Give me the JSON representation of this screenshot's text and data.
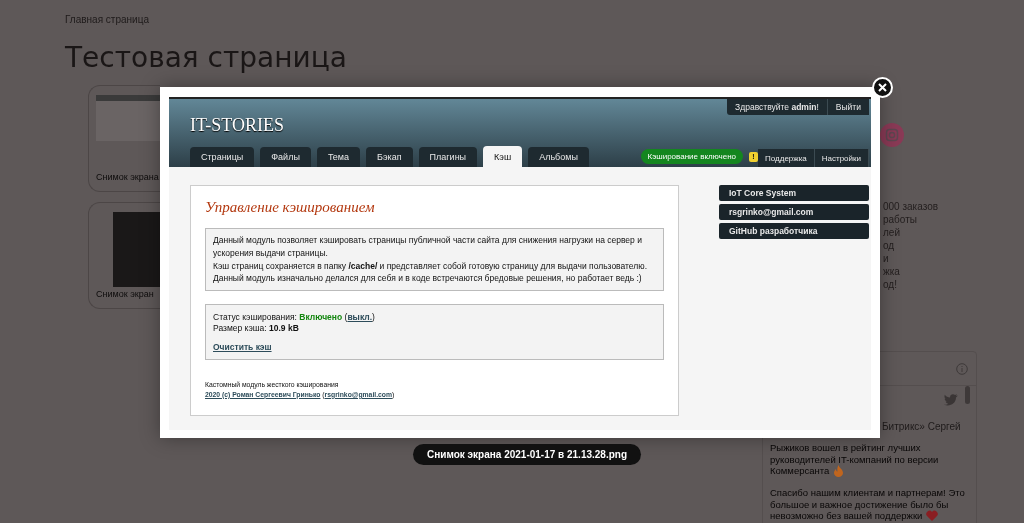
{
  "page": {
    "breadcrumb": "Главная страница",
    "title": "Тестовая страница",
    "gallery": [
      {
        "caption": "Снимок экрана",
        "kind": "light"
      },
      {
        "caption": "Снимок экран",
        "kind": "dark"
      }
    ],
    "side_text": [
      "000 заказов",
      "работы",
      "лей",
      "од",
      "и",
      "жка",
      "од!"
    ],
    "widget": {
      "lead": "Битрикс» Сергей",
      "lines": [
        {
          "text": "Рыжиков вошел в рейтинг лучших",
          "kind": "plain"
        },
        {
          "text": "руководителей IT-компаний по версии",
          "kind": "plain"
        },
        {
          "text": "Коммерсанта",
          "kind": "fire"
        },
        {
          "text": "Спасибо нашим клиентам и партнерам! Это",
          "kind": "gap"
        },
        {
          "text": "большое и важное достижение было бы",
          "kind": "plain"
        },
        {
          "text": "невозможно без вашей поддержки",
          "kind": "heart"
        }
      ]
    }
  },
  "lightbox": {
    "caption": "Снимок экрана 2021-01-17 в 21.13.28.png",
    "admin": {
      "logo": "IT-STORIES",
      "greeting": "Здравствуйте **admin**!",
      "logout": "Выйти",
      "tabs": [
        {
          "label": "Страницы",
          "selected": false
        },
        {
          "label": "Файлы",
          "selected": false
        },
        {
          "label": "Тема",
          "selected": false
        },
        {
          "label": "Бэкап",
          "selected": false
        },
        {
          "label": "Плагины",
          "selected": false
        },
        {
          "label": "Кэш",
          "selected": true
        },
        {
          "label": "Альбомы",
          "selected": false
        }
      ],
      "status_badge": "Кэширование включено",
      "alert_mark": "!",
      "links": [
        "Поддержка",
        "Настройки"
      ],
      "heading": "Управление кэшированием",
      "description": [
        "Данный модуль позволяет кэшировать страницы публичной части сайта для снижения нагрузки на сервер и ускорения выдачи страницы.",
        "Кэш страниц сохраняется в папку **/cache/** и представляет собой готовую страницу для выдачи пользователю.",
        "Данный модуль изначально делался для себя и в коде встречаются бредовые решения, но работает ведь :)"
      ],
      "status": {
        "label": "Статус кэширования:",
        "value": "Включено",
        "enabled": true,
        "link_prefix": "(",
        "link": "выкл.",
        "link_suffix": ")",
        "size": "Размер кэша: **10.9 kB**",
        "clear_link": "Очистить кэш"
      },
      "footer": {
        "note": "Кастомный модуль жесткого кэширования",
        "author_link": "2020 (c) Роман Сергеевич Гринько",
        "email_prefix": "(",
        "email_link": "rsgrinko@gmail.com",
        "email_suffix": ")"
      },
      "sidebar_links": [
        "IoT Core System",
        "rsgrinko@gmail.com",
        "GitHub разработчика"
      ]
    }
  }
}
